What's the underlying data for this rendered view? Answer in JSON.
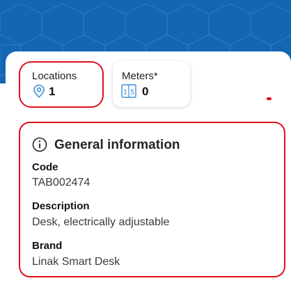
{
  "colors": {
    "header_blue": "#1565b5",
    "highlight_red": "#e0101c",
    "icon_blue": "#3b8fd6"
  },
  "summary": {
    "locations": {
      "label": "Locations",
      "value": "1",
      "icon": "location-pin-icon"
    },
    "meters": {
      "label": "Meters*",
      "value": "0",
      "icon": "meter-counter-icon",
      "icon_digits": [
        "1",
        "5"
      ]
    }
  },
  "general_info": {
    "title": "General information",
    "icon": "info-circle-icon",
    "fields": [
      {
        "label": "Code",
        "value": "TAB002474"
      },
      {
        "label": "Description",
        "value": "Desk, electrically adjustable"
      },
      {
        "label": "Brand",
        "value": "Linak Smart Desk"
      }
    ]
  }
}
